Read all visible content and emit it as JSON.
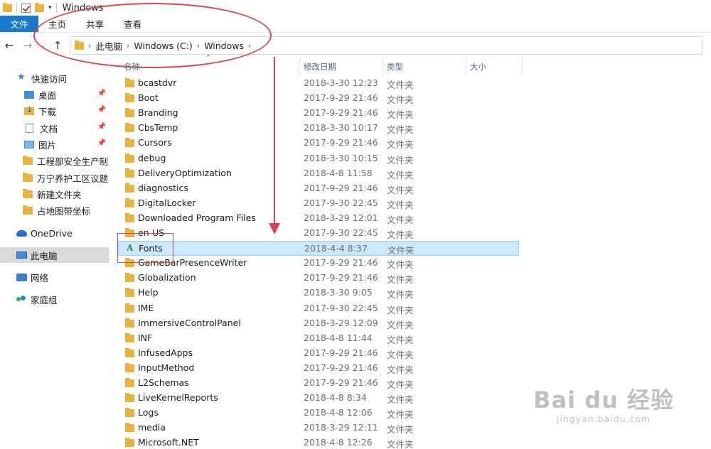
{
  "window": {
    "title": "Windows"
  },
  "ribbon": {
    "tabs": [
      "文件",
      "主页",
      "共享",
      "查看"
    ]
  },
  "nav": {
    "back_icon": "←",
    "forward_icon": "→",
    "recent_icon": "⌄",
    "up_icon": "↑",
    "breadcrumb": [
      "此电脑",
      "Windows (C:)",
      "Windows"
    ]
  },
  "sidebar": {
    "quick_access": "快速访问",
    "pinned": [
      "桌面",
      "下载",
      "文档",
      "图片"
    ],
    "folders": [
      "工程部安全生产制度",
      "万宁养护工区议题",
      "新建文件夹",
      "占地图带坐标"
    ],
    "onedrive": "OneDrive",
    "this_pc": "此电脑",
    "network": "网络",
    "homegroup": "家庭组"
  },
  "columns": {
    "name": "名称",
    "date": "修改日期",
    "type": "类型",
    "size": "大小"
  },
  "files": [
    {
      "name": "bcastdvr",
      "date": "2018-3-30 12:23",
      "type": "文件夹"
    },
    {
      "name": "Boot",
      "date": "2017-9-29 21:46",
      "type": "文件夹"
    },
    {
      "name": "Branding",
      "date": "2017-9-29 21:46",
      "type": "文件夹"
    },
    {
      "name": "CbsTemp",
      "date": "2018-3-30 10:17",
      "type": "文件夹"
    },
    {
      "name": "Cursors",
      "date": "2017-9-29 21:46",
      "type": "文件夹"
    },
    {
      "name": "debug",
      "date": "2018-3-30 10:15",
      "type": "文件夹"
    },
    {
      "name": "DeliveryOptimization",
      "date": "2018-4-8 11:58",
      "type": "文件夹"
    },
    {
      "name": "diagnostics",
      "date": "2017-9-29 21:46",
      "type": "文件夹"
    },
    {
      "name": "DigitalLocker",
      "date": "2017-9-30 22:45",
      "type": "文件夹"
    },
    {
      "name": "Downloaded Program Files",
      "date": "2018-3-29 12:01",
      "type": "文件夹"
    },
    {
      "name": "en-US",
      "date": "2017-9-30 22:45",
      "type": "文件夹"
    },
    {
      "name": "Fonts",
      "date": "2018-4-4 8:37",
      "type": "文件夹",
      "selected": true,
      "icon": "fonts-folder-icon"
    },
    {
      "name": "GameBarPresenceWriter",
      "date": "2017-9-29 21:46",
      "type": "文件夹"
    },
    {
      "name": "Globalization",
      "date": "2017-9-29 21:46",
      "type": "文件夹"
    },
    {
      "name": "Help",
      "date": "2018-3-30 9:05",
      "type": "文件夹"
    },
    {
      "name": "IME",
      "date": "2017-9-30 22:45",
      "type": "文件夹"
    },
    {
      "name": "ImmersiveControlPanel",
      "date": "2018-3-29 12:09",
      "type": "文件夹"
    },
    {
      "name": "INF",
      "date": "2018-4-8 11:44",
      "type": "文件夹"
    },
    {
      "name": "InfusedApps",
      "date": "2017-9-29 21:46",
      "type": "文件夹"
    },
    {
      "name": "InputMethod",
      "date": "2017-9-29 21:46",
      "type": "文件夹"
    },
    {
      "name": "L2Schemas",
      "date": "2017-9-29 21:46",
      "type": "文件夹"
    },
    {
      "name": "LiveKernelReports",
      "date": "2018-4-8 8:34",
      "type": "文件夹"
    },
    {
      "name": "Logs",
      "date": "2018-4-8 12:06",
      "type": "文件夹"
    },
    {
      "name": "media",
      "date": "2018-3-29 12:11",
      "type": "文件夹"
    },
    {
      "name": "Microsoft.NET",
      "date": "2018-4-8 12:26",
      "type": "文件夹"
    }
  ],
  "watermark": {
    "main": "Bai du 经验",
    "sub": "jingyan.baidu.com"
  },
  "colors": {
    "file_tab": "#1979ca",
    "selected_row": "#cce8ff",
    "annotation": "#d6454b",
    "folder": "#e8b440"
  }
}
